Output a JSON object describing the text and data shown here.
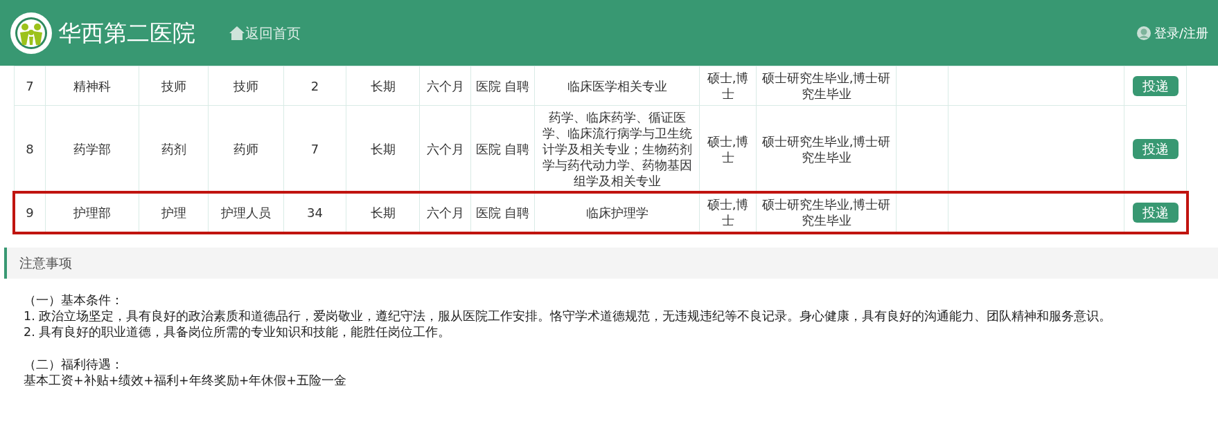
{
  "header": {
    "title": "华西第二医院",
    "home_link": "返回首页",
    "login_link": "登录/注册"
  },
  "table": {
    "rows": [
      {
        "cells": [
          "7",
          "精神科",
          "技师",
          "技师",
          "2",
          "长期",
          "六个月",
          "医院 自聘",
          "临床医学相关专业",
          "硕士,博士",
          "硕士研究生毕业,博士研究生毕业"
        ],
        "action": "投递",
        "highlighted": false
      },
      {
        "cells": [
          "8",
          "药学部",
          "药剂",
          "药师",
          "7",
          "长期",
          "六个月",
          "医院 自聘",
          "药学、临床药学、循证医学、临床流行病学与卫生统计学及相关专业；生物药剂学与药代动力学、药物基因组学及相关专业",
          "硕士,博士",
          "硕士研究生毕业,博士研究生毕业"
        ],
        "action": "投递",
        "highlighted": false
      },
      {
        "cells": [
          "9",
          "护理部",
          "护理",
          "护理人员",
          "34",
          "长期",
          "六个月",
          "医院 自聘",
          "临床护理学",
          "硕士,博士",
          "硕士研究生毕业,博士研究生毕业"
        ],
        "action": "投递",
        "highlighted": true
      }
    ]
  },
  "notes": {
    "title": "注意事项",
    "sections": [
      {
        "paragraphs": [
          "（一）基本条件：",
          "1. 政治立场坚定，具有良好的政治素质和道德品行，爱岗敬业，遵纪守法，服从医院工作安排。恪守学术道德规范，无违规违纪等不良记录。身心健康，具有良好的沟通能力、团队精神和服务意识。",
          "2. 具有良好的职业道德，具备岗位所需的专业知识和技能，能胜任岗位工作。"
        ]
      },
      {
        "paragraphs": [
          "（二）福利待遇：",
          "基本工资+补贴+绩效+福利+年终奖励+年休假+五险一金"
        ]
      }
    ]
  }
}
